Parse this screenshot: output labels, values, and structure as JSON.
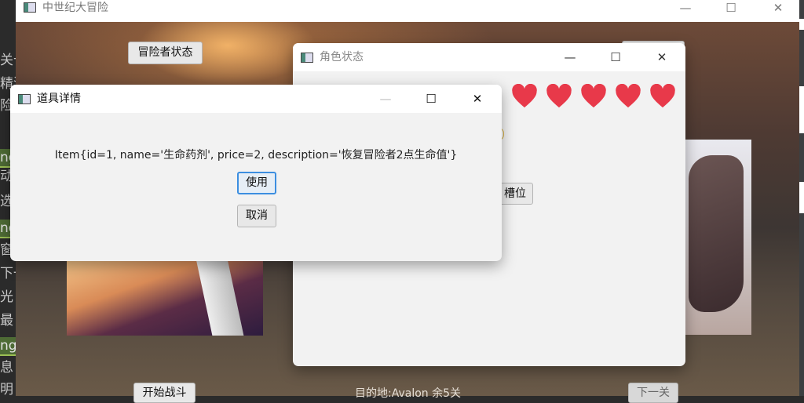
{
  "ide_lines": [
    "关卡",
    "精湛",
    "险",
    "ng",
    "动",
    "选",
    "ng",
    "窗",
    "下一",
    "光",
    "最",
    "ng",
    "息",
    "明"
  ],
  "main_window": {
    "title": "中世纪大冒险",
    "adventurer_status_button": "冒险者状态",
    "start_battle_button": "开始战斗",
    "destination_text": "目的地:Avalon 余5关",
    "next_level_button": "下一关"
  },
  "status_window": {
    "title": "角色状态",
    "hearts_visible": 5,
    "slot_button": "槽位"
  },
  "detail_dialog": {
    "title": "道具详情",
    "item_text": "Item{id=1, name='生命药剂', price=2, description='恢复冒险者2点生命值'}",
    "use_button": "使用",
    "cancel_button": "取消"
  },
  "window_controls": {
    "minimize": "—",
    "maximize": "☐",
    "close": "✕"
  },
  "colors": {
    "heart": "#e8394a",
    "accent_focus": "#3c8ee0",
    "titlebar": "#ffffff",
    "window_bg": "#f2f2f2"
  }
}
